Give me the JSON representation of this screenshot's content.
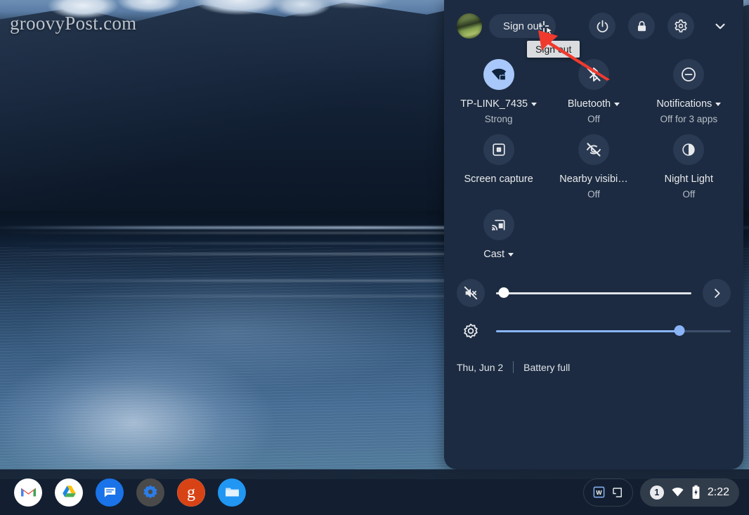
{
  "wallpaper": {
    "watermark": "groovyPost.com"
  },
  "quick_settings": {
    "header": {
      "avatar": "user-avatar",
      "sign_out_label": "Sign out",
      "power_icon": "power-icon",
      "lock_icon": "lock-icon",
      "settings_icon": "gear-icon",
      "collapse_icon": "chevron-down-icon"
    },
    "tooltip": {
      "text": "Sign out"
    },
    "tiles": [
      {
        "id": "network",
        "icon": "wifi-lock-icon",
        "label": "TP-LINK_7435",
        "sub": "Strong",
        "caret": true,
        "active": true
      },
      {
        "id": "bluetooth",
        "icon": "bluetooth-off-icon",
        "label": "Bluetooth",
        "sub": "Off",
        "caret": true,
        "active": false
      },
      {
        "id": "notifications",
        "icon": "do-not-disturb-icon",
        "label": "Notifications",
        "sub": "Off for 3 apps",
        "caret": true,
        "active": false
      },
      {
        "id": "screen_capture",
        "icon": "screen-capture-icon",
        "label": "Screen capture",
        "sub": "",
        "caret": false,
        "active": false
      },
      {
        "id": "nearby",
        "icon": "eye-off-icon",
        "label": "Nearby visibi…",
        "sub": "Off",
        "caret": false,
        "active": false
      },
      {
        "id": "night_light",
        "icon": "night-light-icon",
        "label": "Night Light",
        "sub": "Off",
        "caret": false,
        "active": false
      },
      {
        "id": "cast",
        "icon": "cast-icon",
        "label": "Cast",
        "sub": "",
        "caret": true,
        "active": false
      }
    ],
    "volume_slider": {
      "icon": "volume-mute-icon",
      "value": 4,
      "expand_icon": "chevron-right-icon"
    },
    "brightness_slider": {
      "icon": "brightness-icon",
      "value": 78
    },
    "footer": {
      "date": "Thu, Jun 2",
      "battery": "Battery full"
    }
  },
  "shelf": {
    "apps": [
      {
        "name": "gmail-app",
        "label": "Gmail"
      },
      {
        "name": "drive-app",
        "label": "Google Drive"
      },
      {
        "name": "messages-app",
        "label": "Messages"
      },
      {
        "name": "settings-app",
        "label": "Settings"
      },
      {
        "name": "groovypost-app",
        "label": "g"
      },
      {
        "name": "files-app",
        "label": "Files"
      }
    ],
    "window_group": {
      "word_icon": "word-doc-icon",
      "window_icon": "window-icon"
    },
    "status": {
      "notification_count": "1",
      "wifi_icon": "wifi-icon",
      "battery_icon": "battery-charging-icon",
      "time": "2:22"
    }
  },
  "annotation": {
    "arrow": "red-arrow-pointing-to-power-button"
  },
  "colors": {
    "panel_bg": "#1c2b41",
    "tile_bg": "#2a3a52",
    "accent_blue": "#8ab4f8",
    "active_tile": "#a8c7fa",
    "arrow_red": "#f03a2e",
    "tooltip_bg": "#dadce0"
  }
}
